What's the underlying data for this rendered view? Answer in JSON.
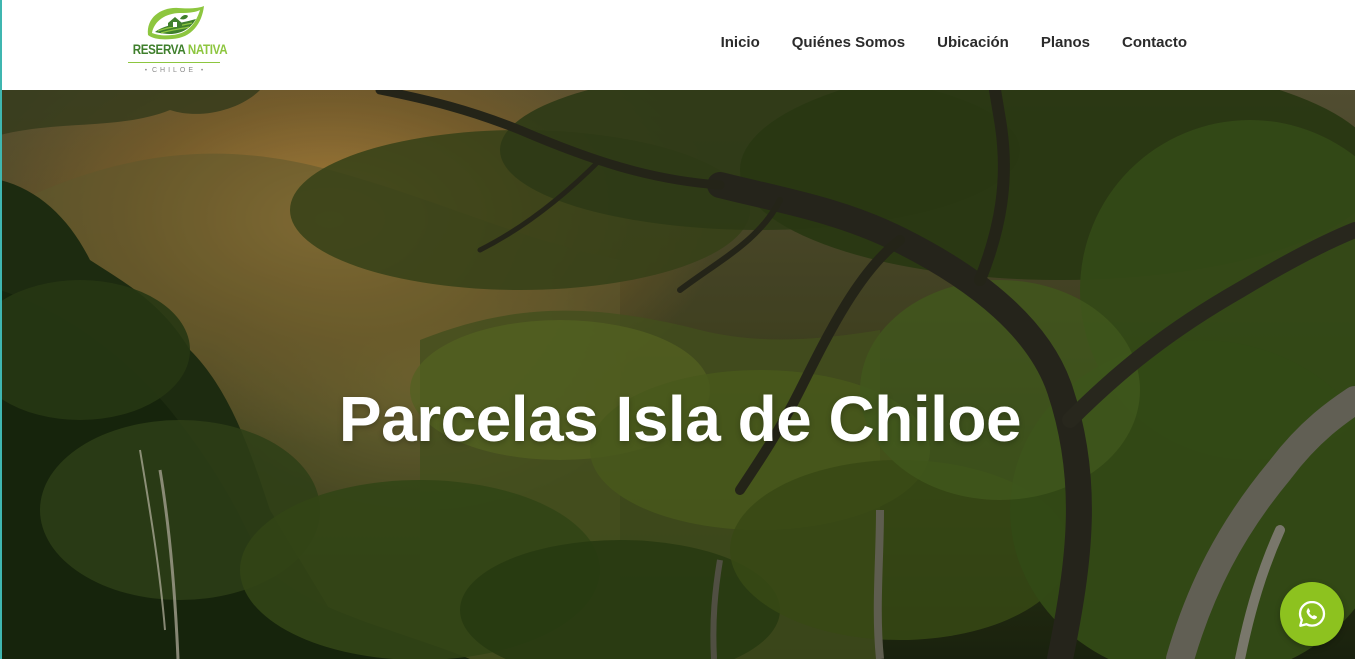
{
  "brand": {
    "name_part1": "RESERVA",
    "name_part2": "NATIVA",
    "subtitle": "CHILOE",
    "logo_icon": "leaf-farmhouse-icon",
    "colors": {
      "dark_green": "#3f7f2c",
      "light_green": "#8dc63f"
    }
  },
  "nav": {
    "items": [
      {
        "label": "Inicio"
      },
      {
        "label": "Quiénes Somos"
      },
      {
        "label": "Ubicación"
      },
      {
        "label": "Planos"
      },
      {
        "label": "Contacto"
      }
    ]
  },
  "hero": {
    "title": "Parcelas Isla de Chiloe",
    "background": "forest-canopy-photo"
  },
  "whatsapp": {
    "icon": "whatsapp-icon",
    "color": "#8dc21f"
  }
}
